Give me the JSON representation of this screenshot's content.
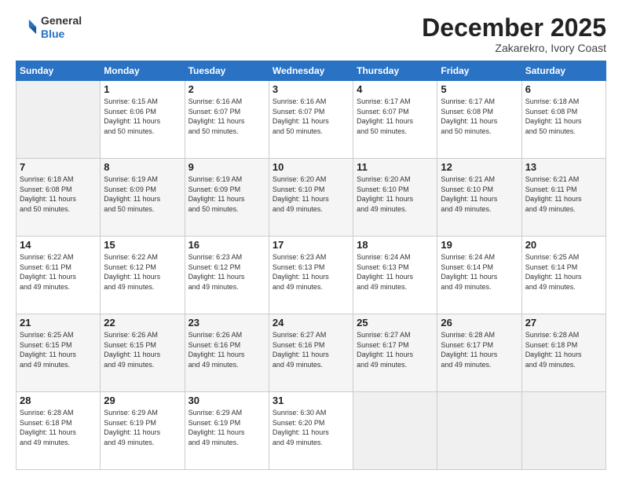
{
  "header": {
    "logo_general": "General",
    "logo_blue": "Blue",
    "month": "December 2025",
    "location": "Zakarekro, Ivory Coast"
  },
  "days_of_week": [
    "Sunday",
    "Monday",
    "Tuesday",
    "Wednesday",
    "Thursday",
    "Friday",
    "Saturday"
  ],
  "weeks": [
    [
      {
        "day": "",
        "text": ""
      },
      {
        "day": "1",
        "text": "Sunrise: 6:15 AM\nSunset: 6:06 PM\nDaylight: 11 hours\nand 50 minutes."
      },
      {
        "day": "2",
        "text": "Sunrise: 6:16 AM\nSunset: 6:07 PM\nDaylight: 11 hours\nand 50 minutes."
      },
      {
        "day": "3",
        "text": "Sunrise: 6:16 AM\nSunset: 6:07 PM\nDaylight: 11 hours\nand 50 minutes."
      },
      {
        "day": "4",
        "text": "Sunrise: 6:17 AM\nSunset: 6:07 PM\nDaylight: 11 hours\nand 50 minutes."
      },
      {
        "day": "5",
        "text": "Sunrise: 6:17 AM\nSunset: 6:08 PM\nDaylight: 11 hours\nand 50 minutes."
      },
      {
        "day": "6",
        "text": "Sunrise: 6:18 AM\nSunset: 6:08 PM\nDaylight: 11 hours\nand 50 minutes."
      }
    ],
    [
      {
        "day": "7",
        "text": "Sunrise: 6:18 AM\nSunset: 6:08 PM\nDaylight: 11 hours\nand 50 minutes."
      },
      {
        "day": "8",
        "text": "Sunrise: 6:19 AM\nSunset: 6:09 PM\nDaylight: 11 hours\nand 50 minutes."
      },
      {
        "day": "9",
        "text": "Sunrise: 6:19 AM\nSunset: 6:09 PM\nDaylight: 11 hours\nand 50 minutes."
      },
      {
        "day": "10",
        "text": "Sunrise: 6:20 AM\nSunset: 6:10 PM\nDaylight: 11 hours\nand 49 minutes."
      },
      {
        "day": "11",
        "text": "Sunrise: 6:20 AM\nSunset: 6:10 PM\nDaylight: 11 hours\nand 49 minutes."
      },
      {
        "day": "12",
        "text": "Sunrise: 6:21 AM\nSunset: 6:10 PM\nDaylight: 11 hours\nand 49 minutes."
      },
      {
        "day": "13",
        "text": "Sunrise: 6:21 AM\nSunset: 6:11 PM\nDaylight: 11 hours\nand 49 minutes."
      }
    ],
    [
      {
        "day": "14",
        "text": "Sunrise: 6:22 AM\nSunset: 6:11 PM\nDaylight: 11 hours\nand 49 minutes."
      },
      {
        "day": "15",
        "text": "Sunrise: 6:22 AM\nSunset: 6:12 PM\nDaylight: 11 hours\nand 49 minutes."
      },
      {
        "day": "16",
        "text": "Sunrise: 6:23 AM\nSunset: 6:12 PM\nDaylight: 11 hours\nand 49 minutes."
      },
      {
        "day": "17",
        "text": "Sunrise: 6:23 AM\nSunset: 6:13 PM\nDaylight: 11 hours\nand 49 minutes."
      },
      {
        "day": "18",
        "text": "Sunrise: 6:24 AM\nSunset: 6:13 PM\nDaylight: 11 hours\nand 49 minutes."
      },
      {
        "day": "19",
        "text": "Sunrise: 6:24 AM\nSunset: 6:14 PM\nDaylight: 11 hours\nand 49 minutes."
      },
      {
        "day": "20",
        "text": "Sunrise: 6:25 AM\nSunset: 6:14 PM\nDaylight: 11 hours\nand 49 minutes."
      }
    ],
    [
      {
        "day": "21",
        "text": "Sunrise: 6:25 AM\nSunset: 6:15 PM\nDaylight: 11 hours\nand 49 minutes."
      },
      {
        "day": "22",
        "text": "Sunrise: 6:26 AM\nSunset: 6:15 PM\nDaylight: 11 hours\nand 49 minutes."
      },
      {
        "day": "23",
        "text": "Sunrise: 6:26 AM\nSunset: 6:16 PM\nDaylight: 11 hours\nand 49 minutes."
      },
      {
        "day": "24",
        "text": "Sunrise: 6:27 AM\nSunset: 6:16 PM\nDaylight: 11 hours\nand 49 minutes."
      },
      {
        "day": "25",
        "text": "Sunrise: 6:27 AM\nSunset: 6:17 PM\nDaylight: 11 hours\nand 49 minutes."
      },
      {
        "day": "26",
        "text": "Sunrise: 6:28 AM\nSunset: 6:17 PM\nDaylight: 11 hours\nand 49 minutes."
      },
      {
        "day": "27",
        "text": "Sunrise: 6:28 AM\nSunset: 6:18 PM\nDaylight: 11 hours\nand 49 minutes."
      }
    ],
    [
      {
        "day": "28",
        "text": "Sunrise: 6:28 AM\nSunset: 6:18 PM\nDaylight: 11 hours\nand 49 minutes."
      },
      {
        "day": "29",
        "text": "Sunrise: 6:29 AM\nSunset: 6:19 PM\nDaylight: 11 hours\nand 49 minutes."
      },
      {
        "day": "30",
        "text": "Sunrise: 6:29 AM\nSunset: 6:19 PM\nDaylight: 11 hours\nand 49 minutes."
      },
      {
        "day": "31",
        "text": "Sunrise: 6:30 AM\nSunset: 6:20 PM\nDaylight: 11 hours\nand 49 minutes."
      },
      {
        "day": "",
        "text": ""
      },
      {
        "day": "",
        "text": ""
      },
      {
        "day": "",
        "text": ""
      }
    ]
  ]
}
